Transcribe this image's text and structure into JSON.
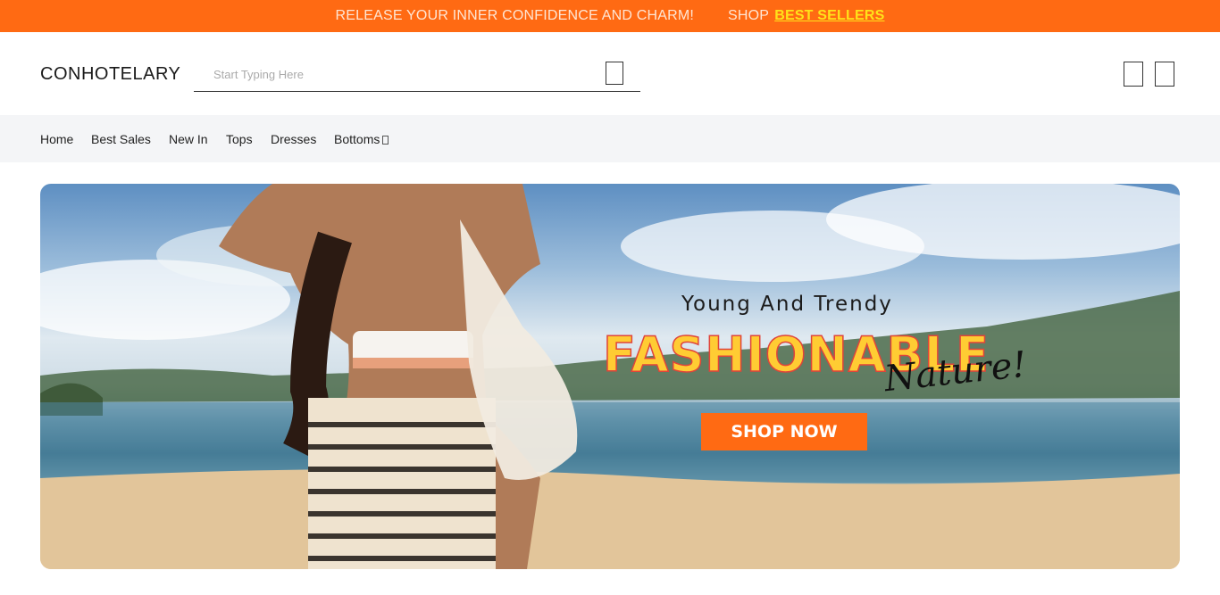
{
  "promo": {
    "message": "RELEASE YOUR INNER CONFIDENCE AND CHARM!",
    "shop_prefix": "SHOP",
    "link": "BEST SELLERS"
  },
  "header": {
    "logo": "CONHOTELARY",
    "search_placeholder": "Start Typing Here"
  },
  "nav": {
    "items": [
      "Home",
      "Best Sales",
      "New In",
      "Tops",
      "Dresses",
      "Bottoms"
    ]
  },
  "banner": {
    "tagline": "Young And Trendy",
    "headline": "FASHIONABLE",
    "script": "Nature!",
    "cta": "SHOP NOW"
  },
  "colors": {
    "accent": "#ff6a13",
    "highlight": "#ffe21a"
  },
  "icons": [
    "search-icon",
    "account-icon",
    "cart-icon",
    "chevron-down-icon"
  ]
}
